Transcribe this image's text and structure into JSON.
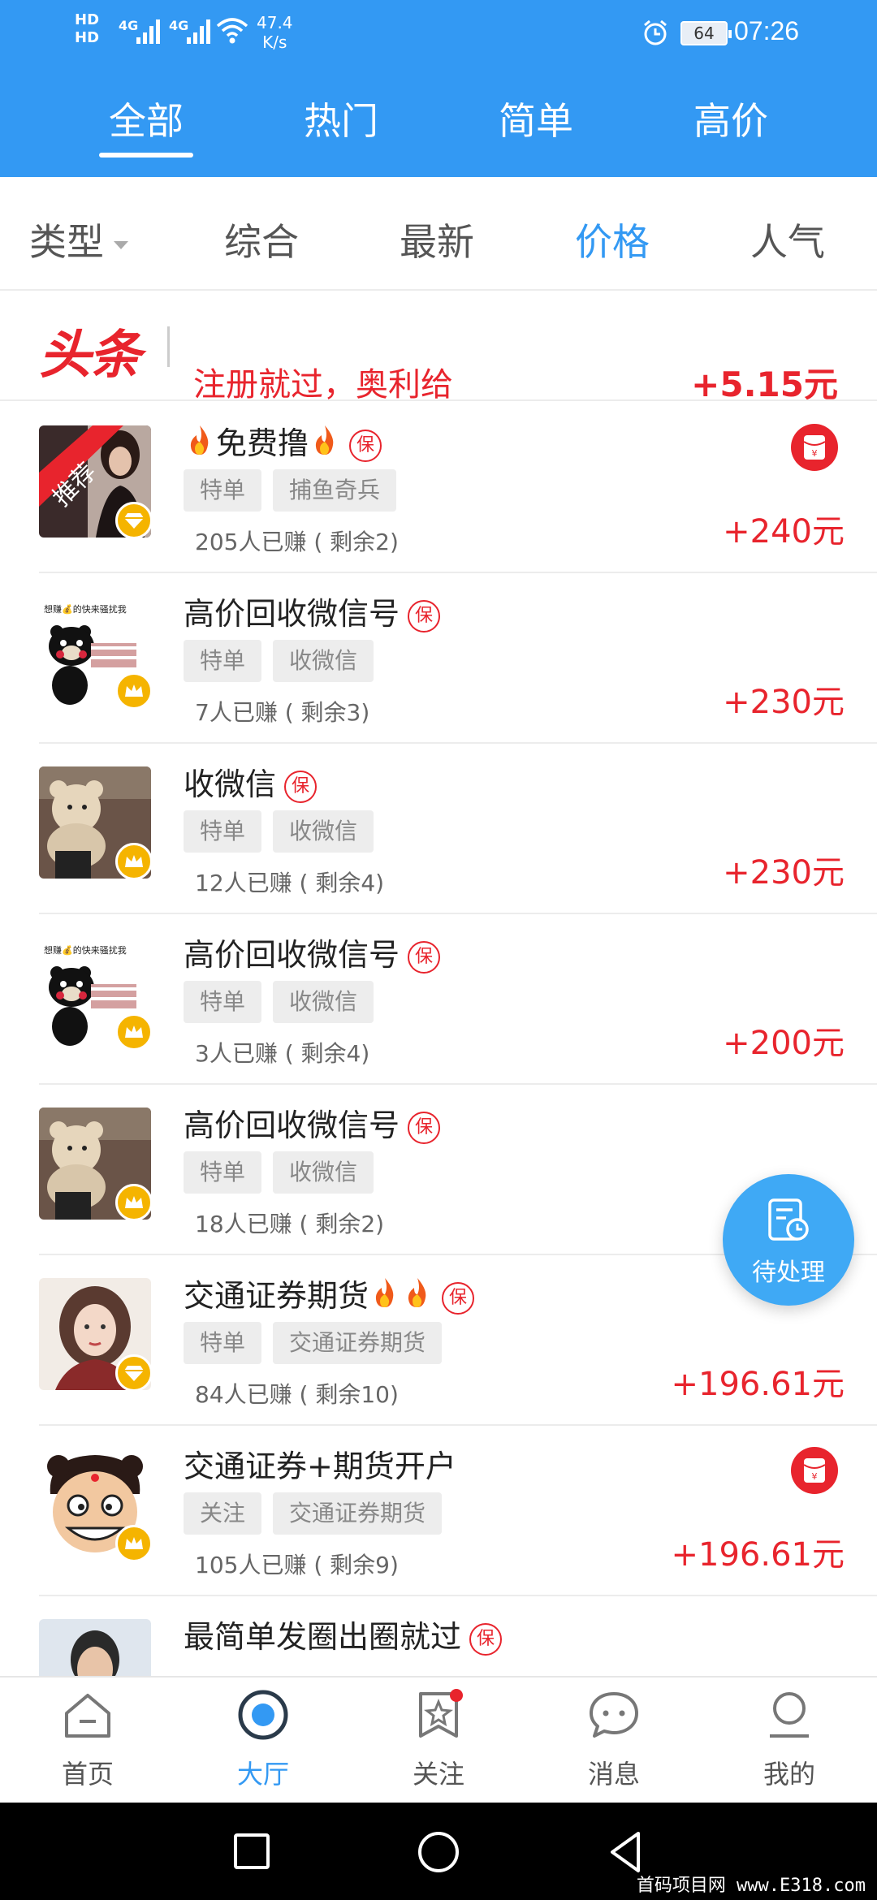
{
  "status_bar": {
    "hd1": "HD",
    "hd2": "HD",
    "net1": "4G",
    "net2": "4G",
    "speed_value": "47.4",
    "speed_unit": "K/s",
    "battery": "64",
    "time": "07:26"
  },
  "tabs": [
    {
      "label": "全部",
      "active": true
    },
    {
      "label": "热门"
    },
    {
      "label": "简单"
    },
    {
      "label": "高价"
    }
  ],
  "sort": {
    "type_label": "类型",
    "items": [
      {
        "label": "综合"
      },
      {
        "label": "最新"
      },
      {
        "label": "价格",
        "active": true
      },
      {
        "label": "人气"
      }
    ]
  },
  "headline": {
    "logo": "头条",
    "text": "注册就过，奥利给",
    "amount": "+5.15元"
  },
  "bao_label": "保",
  "tasks": [
    {
      "title": "免费撸",
      "tags": [
        "特单",
        "捕鱼奇兵"
      ],
      "earned": "205人已赚 ( 剩余2)",
      "amount": "+240元",
      "avatar": "recommend-girl",
      "badge": "diamond",
      "fires": "both"
    },
    {
      "title": "高价回收微信号",
      "tags": [
        "特单",
        "收微信"
      ],
      "earned": "7人已赚 ( 剩余3)",
      "amount": "+230元",
      "avatar": "bear",
      "badge": "crown"
    },
    {
      "title": "收微信",
      "tags": [
        "特单",
        "收微信"
      ],
      "earned": "12人已赚 ( 剩余4)",
      "amount": "+230元",
      "avatar": "teddy",
      "badge": "crown"
    },
    {
      "title": "高价回收微信号",
      "tags": [
        "特单",
        "收微信"
      ],
      "earned": "3人已赚 ( 剩余4)",
      "amount": "+200元",
      "avatar": "bear",
      "badge": "crown"
    },
    {
      "title": "高价回收微信号",
      "tags": [
        "特单",
        "收微信"
      ],
      "earned": "18人已赚 ( 剩余2)",
      "amount": "",
      "avatar": "teddy",
      "badge": "crown"
    },
    {
      "title": "交通证券期货",
      "tags": [
        "特单",
        "交通证券期货"
      ],
      "earned": "84人已赚 ( 剩余10)",
      "amount": "+196.61元",
      "avatar": "girl",
      "badge": "diamond",
      "fires": "after"
    },
    {
      "title": "交通证券+期货开户",
      "tags": [
        "关注",
        "交通证券期货"
      ],
      "earned": "105人已赚 ( 剩余9)",
      "amount": "+196.61元",
      "avatar": "cartoon",
      "badge": "crown"
    },
    {
      "title": "最简单发圈出圈就过",
      "tags": [
        "",
        ""
      ],
      "earned": "",
      "amount": "",
      "avatar": "man",
      "badge": "none"
    }
  ],
  "bear_caption": "想赚💰的快来骚扰我",
  "recommend_text": "推荐",
  "fab_label": "待处理",
  "bottom_nav": [
    {
      "label": "首页"
    },
    {
      "label": "大厅",
      "active": true
    },
    {
      "label": "关注"
    },
    {
      "label": "消息"
    },
    {
      "label": "我的"
    }
  ],
  "watermark": "首码项目网 www.E318.com",
  "colors": {
    "primary_blue": "#3399f3",
    "accent_red": "#e8242d",
    "badge_gold": "#f5b400"
  }
}
